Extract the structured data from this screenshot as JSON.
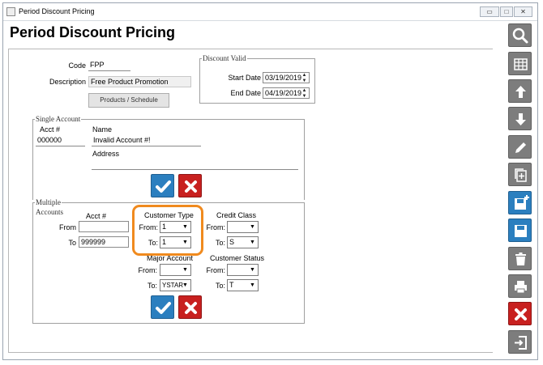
{
  "window": {
    "title": "Period Discount Pricing",
    "heading": "Period Discount Pricing",
    "min": "▭",
    "max": "□",
    "close": "✕"
  },
  "header": {
    "code_label": "Code",
    "code_value": "FPP",
    "desc_label": "Description",
    "desc_value": "Free Product Promotion",
    "products_button": "Products / Schedule"
  },
  "discount_valid": {
    "legend": "Discount Valid",
    "start_label": "Start Date",
    "start_value": "03/19/2019",
    "end_label": "End Date",
    "end_value": "04/19/2019"
  },
  "single_account": {
    "legend": "Single Account",
    "acct_label": "Acct #",
    "acct_value": "000000",
    "name_label": "Name",
    "name_value": "Invalid Account #!",
    "address_label": "Address",
    "address_value": ""
  },
  "multiple_accounts": {
    "legend_line1": "Multiple",
    "legend_line2": "Accounts",
    "acct_label": "Acct #",
    "from_label": "From",
    "to_label": "To",
    "acct_from": "",
    "acct_to": "999999",
    "customer_type": {
      "label": "Customer Type",
      "from_label": "From:",
      "to_label": "To:",
      "from_value": "1",
      "to_value": "1"
    },
    "credit_class": {
      "label": "Credit Class",
      "from_label": "From:",
      "to_label": "To:",
      "from_value": "",
      "to_value": "S"
    },
    "major_account": {
      "label": "Major Account",
      "from_label": "From:",
      "to_label": "To:",
      "from_value": "",
      "to_value": "YSTAR"
    },
    "customer_status": {
      "label": "Customer Status",
      "from_label": "From:",
      "to_label": "To:",
      "from_value": "",
      "to_value": "T"
    }
  },
  "sidebar": [
    "search-icon",
    "grid-icon",
    "arrow-up-icon",
    "arrow-down-icon",
    "pencil-icon",
    "copy-icon",
    "save-new-icon",
    "save-icon",
    "trash-icon",
    "print-icon",
    "close-icon",
    "exit-icon"
  ],
  "colors": {
    "accent_blue": "#2b7fbf",
    "cancel_red": "#c8201f",
    "tool_gray": "#7d7d7d",
    "highlight_orange": "#f08a1e"
  }
}
